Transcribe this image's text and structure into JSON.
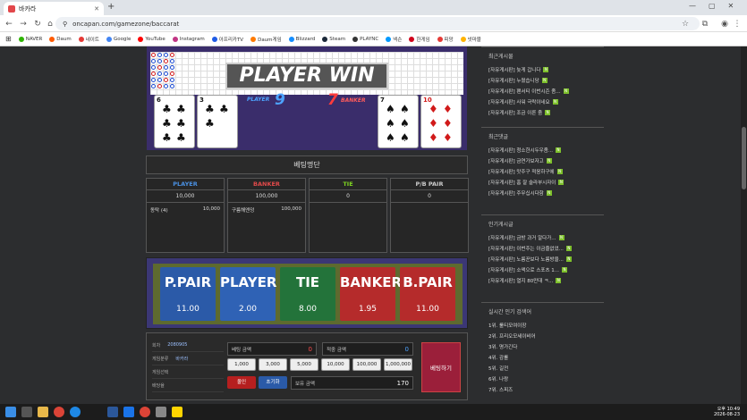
{
  "browser": {
    "tab_title": "바카라",
    "url": "oncapan.com/gamezone/baccarat"
  },
  "bookmarks": [
    {
      "label": "NAVER",
      "color": "#2db400"
    },
    {
      "label": "Daum",
      "color": "#ff5a00"
    },
    {
      "label": "네이트",
      "color": "#e53935"
    },
    {
      "label": "Google",
      "color": "#4285f4"
    },
    {
      "label": "YouTube",
      "color": "#ff0000"
    },
    {
      "label": "Instagram",
      "color": "#c13584"
    },
    {
      "label": "아프리카TV",
      "color": "#1e5be6"
    },
    {
      "label": "Daum게임",
      "color": "#ff7a00"
    },
    {
      "label": "Blizzard",
      "color": "#148eff"
    },
    {
      "label": "Steam",
      "color": "#1b2838"
    },
    {
      "label": "PLAYNC",
      "color": "#333333"
    },
    {
      "label": "넥슨",
      "color": "#0099ff"
    },
    {
      "label": "한게임",
      "color": "#d0021b"
    },
    {
      "label": "피망",
      "color": "#e53935"
    },
    {
      "label": "넷마블",
      "color": "#ffb300"
    }
  ],
  "game": {
    "result": "PLAYER WIN",
    "player_label": "PLAYER",
    "player_score": "9",
    "banker_label": "BANKER",
    "banker_score": "7",
    "cards": [
      {
        "rank": "6",
        "suit": "♣",
        "color": "#111"
      },
      {
        "rank": "3",
        "suit": "♣",
        "color": "#111"
      },
      {
        "rank": "7",
        "suit": "♠",
        "color": "#111"
      },
      {
        "rank": "10",
        "suit": "♦",
        "color": "#d11a1a"
      }
    ]
  },
  "betlist": {
    "title": "베팅명단",
    "columns": [
      {
        "name": "PLAYER",
        "color": "#4a90e2",
        "total": "10,000",
        "rows": [
          {
            "user": "동탁 (4)",
            "amount": "10,000"
          }
        ]
      },
      {
        "name": "BANKER",
        "color": "#e24a4a",
        "total": "100,000",
        "rows": [
          {
            "user": "구름해엔덩",
            "amount": "100,000"
          }
        ]
      },
      {
        "name": "TIE",
        "color": "#7ed321",
        "total": "0",
        "rows": []
      },
      {
        "name": "P/B PAIR",
        "color": "#cccccc",
        "total": "0",
        "rows": []
      }
    ]
  },
  "board": [
    {
      "name": "P.PAIR",
      "odds": "11.00",
      "color": "#2b5aa8"
    },
    {
      "name": "PLAYER",
      "odds": "2.00",
      "color": "#2f62b5"
    },
    {
      "name": "TIE",
      "odds": "8.00",
      "color": "#23733a"
    },
    {
      "name": "BANKER",
      "odds": "1.95",
      "color": "#b52b2b"
    },
    {
      "name": "B.PAIR",
      "odds": "11.00",
      "color": "#b52b2b"
    }
  ],
  "control": {
    "info": [
      {
        "label": "회차",
        "value": "2080905"
      },
      {
        "label": "게임분류",
        "value": "바카라"
      },
      {
        "label": "게임선택",
        "value": ""
      },
      {
        "label": "배당율",
        "value": ""
      }
    ],
    "bet_amount_label": "베팅 금액",
    "bet_amount": "0",
    "win_amount_label": "적중 금액",
    "win_amount": "0",
    "chips": [
      "1,000",
      "3,000",
      "5,000",
      "10,000",
      "100,000",
      "1,000,000"
    ],
    "allin": "올인",
    "reset": "초기화",
    "balance_label": "보유 금액",
    "balance": "170",
    "bet_button": "베팅하기"
  },
  "sidebar": {
    "recent_posts_title": "최근게시물",
    "recent_posts": [
      "[자유게시판] 늦게 갑니다",
      "[자유게시판] 누웠습니당",
      "[자유게시판] 팬서티 이번시즌 좀...",
      "[자유게시판] 사워 극락이네요",
      "[자유게시판] 조금 이른 줌"
    ],
    "recent_comments_title": "최근댓글",
    "recent_comments": [
      "[자유게시판] 청소한시두우좀...",
      "[자유게시판] 금연가보자고",
      "[자유게시판] 맛주구 적응하구에",
      "[자유게시판] 홈 잘 슬라부시자이",
      "[자유게시판] 주무십시다함"
    ],
    "popular_title": "인기게시글",
    "popular": [
      "[자유게시판] 금방 과거 알다가...",
      "[자유게시판] 이번주는 이금줄없었...",
      "[자유게시판] 노름꾼보다 노름방을...",
      "[자유게시판] 소액으로 스포츠 1...",
      "[자유게시판] 열지 80만대 ㅋ..."
    ],
    "search_title": "실시간 인기 검색어",
    "search": [
      "1위. 룰티모여이장",
      "2위. 프리오모세이비어",
      "3위. 명가긴다",
      "4위. 감롤",
      "5위. 길전",
      "6위. 나랑",
      "7위. 스피즈"
    ],
    "new_badge": "N"
  },
  "taskbar": {
    "time": "오후 10:49",
    "date": "2026-08-23"
  }
}
